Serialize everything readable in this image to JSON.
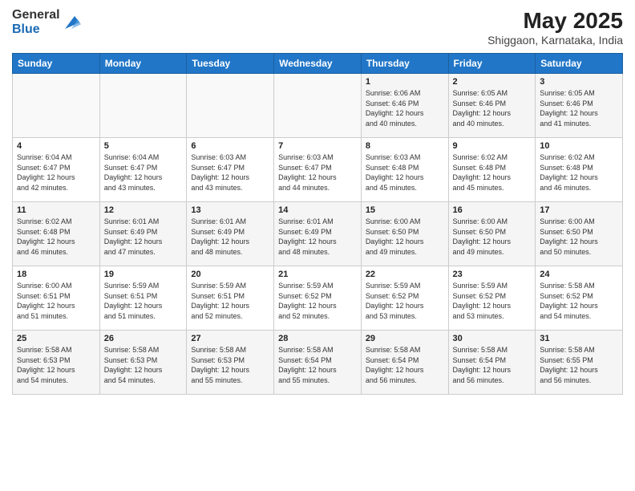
{
  "logo": {
    "general": "General",
    "blue": "Blue"
  },
  "title": {
    "month_year": "May 2025",
    "location": "Shiggaon, Karnataka, India"
  },
  "days_of_week": [
    "Sunday",
    "Monday",
    "Tuesday",
    "Wednesday",
    "Thursday",
    "Friday",
    "Saturday"
  ],
  "weeks": [
    [
      {
        "day": "",
        "info": ""
      },
      {
        "day": "",
        "info": ""
      },
      {
        "day": "",
        "info": ""
      },
      {
        "day": "",
        "info": ""
      },
      {
        "day": "1",
        "info": "Sunrise: 6:06 AM\nSunset: 6:46 PM\nDaylight: 12 hours\nand 40 minutes."
      },
      {
        "day": "2",
        "info": "Sunrise: 6:05 AM\nSunset: 6:46 PM\nDaylight: 12 hours\nand 40 minutes."
      },
      {
        "day": "3",
        "info": "Sunrise: 6:05 AM\nSunset: 6:46 PM\nDaylight: 12 hours\nand 41 minutes."
      }
    ],
    [
      {
        "day": "4",
        "info": "Sunrise: 6:04 AM\nSunset: 6:47 PM\nDaylight: 12 hours\nand 42 minutes."
      },
      {
        "day": "5",
        "info": "Sunrise: 6:04 AM\nSunset: 6:47 PM\nDaylight: 12 hours\nand 43 minutes."
      },
      {
        "day": "6",
        "info": "Sunrise: 6:03 AM\nSunset: 6:47 PM\nDaylight: 12 hours\nand 43 minutes."
      },
      {
        "day": "7",
        "info": "Sunrise: 6:03 AM\nSunset: 6:47 PM\nDaylight: 12 hours\nand 44 minutes."
      },
      {
        "day": "8",
        "info": "Sunrise: 6:03 AM\nSunset: 6:48 PM\nDaylight: 12 hours\nand 45 minutes."
      },
      {
        "day": "9",
        "info": "Sunrise: 6:02 AM\nSunset: 6:48 PM\nDaylight: 12 hours\nand 45 minutes."
      },
      {
        "day": "10",
        "info": "Sunrise: 6:02 AM\nSunset: 6:48 PM\nDaylight: 12 hours\nand 46 minutes."
      }
    ],
    [
      {
        "day": "11",
        "info": "Sunrise: 6:02 AM\nSunset: 6:48 PM\nDaylight: 12 hours\nand 46 minutes."
      },
      {
        "day": "12",
        "info": "Sunrise: 6:01 AM\nSunset: 6:49 PM\nDaylight: 12 hours\nand 47 minutes."
      },
      {
        "day": "13",
        "info": "Sunrise: 6:01 AM\nSunset: 6:49 PM\nDaylight: 12 hours\nand 48 minutes."
      },
      {
        "day": "14",
        "info": "Sunrise: 6:01 AM\nSunset: 6:49 PM\nDaylight: 12 hours\nand 48 minutes."
      },
      {
        "day": "15",
        "info": "Sunrise: 6:00 AM\nSunset: 6:50 PM\nDaylight: 12 hours\nand 49 minutes."
      },
      {
        "day": "16",
        "info": "Sunrise: 6:00 AM\nSunset: 6:50 PM\nDaylight: 12 hours\nand 49 minutes."
      },
      {
        "day": "17",
        "info": "Sunrise: 6:00 AM\nSunset: 6:50 PM\nDaylight: 12 hours\nand 50 minutes."
      }
    ],
    [
      {
        "day": "18",
        "info": "Sunrise: 6:00 AM\nSunset: 6:51 PM\nDaylight: 12 hours\nand 51 minutes."
      },
      {
        "day": "19",
        "info": "Sunrise: 5:59 AM\nSunset: 6:51 PM\nDaylight: 12 hours\nand 51 minutes."
      },
      {
        "day": "20",
        "info": "Sunrise: 5:59 AM\nSunset: 6:51 PM\nDaylight: 12 hours\nand 52 minutes."
      },
      {
        "day": "21",
        "info": "Sunrise: 5:59 AM\nSunset: 6:52 PM\nDaylight: 12 hours\nand 52 minutes."
      },
      {
        "day": "22",
        "info": "Sunrise: 5:59 AM\nSunset: 6:52 PM\nDaylight: 12 hours\nand 53 minutes."
      },
      {
        "day": "23",
        "info": "Sunrise: 5:59 AM\nSunset: 6:52 PM\nDaylight: 12 hours\nand 53 minutes."
      },
      {
        "day": "24",
        "info": "Sunrise: 5:58 AM\nSunset: 6:52 PM\nDaylight: 12 hours\nand 54 minutes."
      }
    ],
    [
      {
        "day": "25",
        "info": "Sunrise: 5:58 AM\nSunset: 6:53 PM\nDaylight: 12 hours\nand 54 minutes."
      },
      {
        "day": "26",
        "info": "Sunrise: 5:58 AM\nSunset: 6:53 PM\nDaylight: 12 hours\nand 54 minutes."
      },
      {
        "day": "27",
        "info": "Sunrise: 5:58 AM\nSunset: 6:53 PM\nDaylight: 12 hours\nand 55 minutes."
      },
      {
        "day": "28",
        "info": "Sunrise: 5:58 AM\nSunset: 6:54 PM\nDaylight: 12 hours\nand 55 minutes."
      },
      {
        "day": "29",
        "info": "Sunrise: 5:58 AM\nSunset: 6:54 PM\nDaylight: 12 hours\nand 56 minutes."
      },
      {
        "day": "30",
        "info": "Sunrise: 5:58 AM\nSunset: 6:54 PM\nDaylight: 12 hours\nand 56 minutes."
      },
      {
        "day": "31",
        "info": "Sunrise: 5:58 AM\nSunset: 6:55 PM\nDaylight: 12 hours\nand 56 minutes."
      }
    ]
  ]
}
